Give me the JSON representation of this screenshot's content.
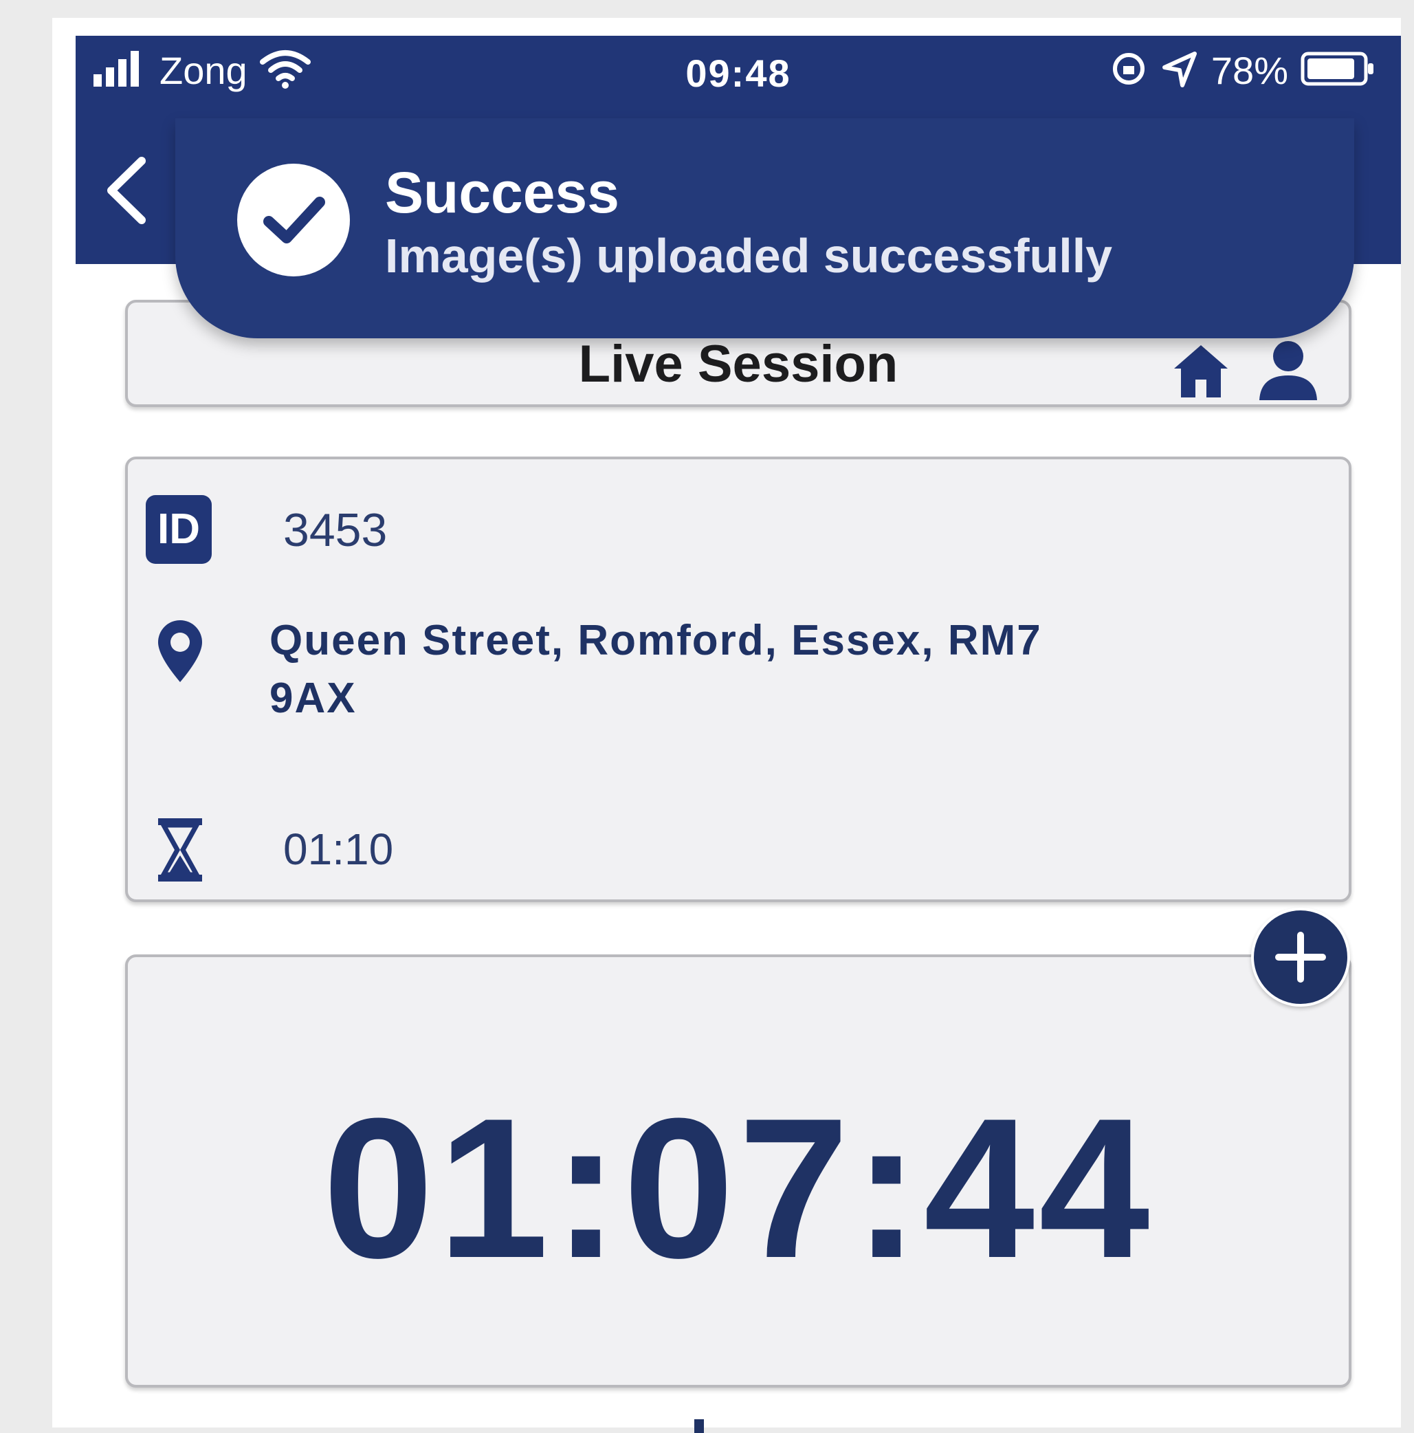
{
  "status_bar": {
    "carrier": "Zong",
    "time": "09:48",
    "battery": "78%",
    "icons": [
      "signal-icon",
      "wifi-icon",
      "orientation-lock-icon",
      "location-arrow-icon",
      "battery-icon"
    ]
  },
  "nav": {
    "back_icon": "chevron-left-icon"
  },
  "toast": {
    "title": "Success",
    "message": "Image(s) uploaded successfully",
    "icon": "check-circle-icon"
  },
  "header": {
    "title": "Live Session",
    "icons": [
      "home-icon",
      "user-icon"
    ]
  },
  "session": {
    "id": "3453",
    "address": "Queen Street, Romford, Essex, RM7 9AX",
    "duration": "01:10",
    "icons": [
      "id-icon",
      "location-pin-icon",
      "hourglass-icon"
    ]
  },
  "timer": {
    "elapsed": "01:07:44",
    "add_icon": "plus-icon"
  },
  "colors": {
    "brand": "#213677",
    "text_primary": "#1f3264",
    "card_bg": "#f1f1f3"
  }
}
